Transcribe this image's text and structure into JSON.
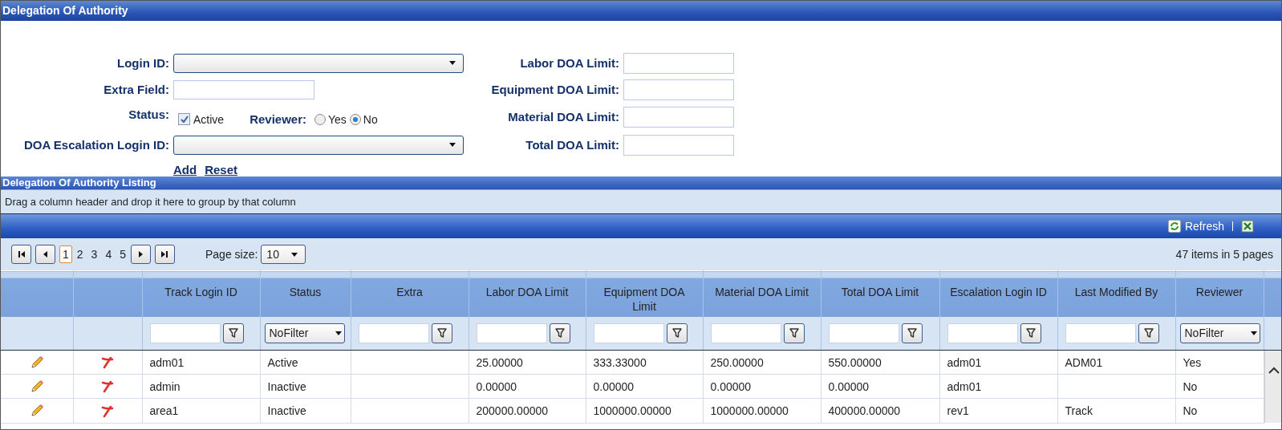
{
  "header": {
    "title": "Delegation Of Authority"
  },
  "form": {
    "rows": [
      {
        "left": {
          "kind": "dropdown",
          "label": "Login ID:"
        },
        "right": {
          "label": "Labor DOA Limit:"
        }
      },
      {
        "left": {
          "kind": "text",
          "label": "Extra Field:"
        },
        "right": {
          "label": "Equipment DOA Limit:"
        }
      },
      {
        "left": {
          "kind": "status",
          "label": "Status:",
          "checkbox": {
            "label": "Active",
            "checked": true
          },
          "reviewer": {
            "label": "Reviewer:",
            "options": [
              {
                "label": "Yes",
                "selected": false
              },
              {
                "label": "No",
                "selected": true
              }
            ]
          }
        },
        "right": {
          "label": "Material DOA Limit:"
        }
      },
      {
        "left": {
          "kind": "dropdown",
          "label": "DOA Escalation Login ID:"
        },
        "right": {
          "label": "Total DOA Limit:"
        }
      }
    ],
    "links": [
      "Add",
      "Reset"
    ]
  },
  "listing": {
    "title": "Delegation Of Authority Listing",
    "group_hint": "Drag a column header and drop it here to group by that column",
    "toolbar": {
      "refresh": "Refresh"
    },
    "pager": {
      "pages": [
        {
          "label": "1",
          "selected": true
        },
        {
          "label": "2",
          "selected": false
        },
        {
          "label": "3",
          "selected": false
        },
        {
          "label": "4",
          "selected": false
        },
        {
          "label": "5",
          "selected": false
        }
      ],
      "page_size_label": "Page size:",
      "page_size": "10",
      "summary": "47 items in 5 pages"
    },
    "columns": [
      {
        "kind": "edit"
      },
      {
        "kind": "delete"
      },
      {
        "kind": "text",
        "label": "Track Login ID",
        "filter": {
          "kind": "text"
        }
      },
      {
        "kind": "text",
        "label": "Status",
        "filter": {
          "kind": "dropdown",
          "value": "NoFilter"
        }
      },
      {
        "kind": "text",
        "label": "Extra",
        "filter": {
          "kind": "text"
        }
      },
      {
        "kind": "text",
        "label": "Labor DOA Limit",
        "filter": {
          "kind": "text"
        }
      },
      {
        "kind": "text",
        "label": "Equipment DOA Limit",
        "filter": {
          "kind": "text"
        }
      },
      {
        "kind": "text",
        "label": "Material DOA Limit",
        "filter": {
          "kind": "text"
        }
      },
      {
        "kind": "text",
        "label": "Total DOA Limit",
        "filter": {
          "kind": "text"
        }
      },
      {
        "kind": "text",
        "label": "Escalation Login ID",
        "filter": {
          "kind": "text"
        }
      },
      {
        "kind": "text",
        "label": "Last Modified By",
        "filter": {
          "kind": "text"
        }
      },
      {
        "kind": "text",
        "label": "Reviewer",
        "filter": {
          "kind": "dropdown",
          "value": "NoFilter"
        }
      }
    ],
    "rows": [
      {
        "cells": [
          "",
          "",
          "adm01",
          "Active",
          "",
          "25.00000",
          "333.33000",
          "250.00000",
          "550.00000",
          "adm01",
          "ADM01",
          "Yes"
        ]
      },
      {
        "cells": [
          "",
          "",
          "admin",
          "Inactive",
          "",
          "0.00000",
          "0.00000",
          "0.00000",
          "0.00000",
          "adm01",
          "",
          "No"
        ]
      },
      {
        "cells": [
          "",
          "",
          "area1",
          "Inactive",
          "",
          "200000.00000",
          "1000000.00000",
          "1000000.00000",
          "400000.00000",
          "rev1",
          "Track",
          "No"
        ]
      }
    ]
  }
}
